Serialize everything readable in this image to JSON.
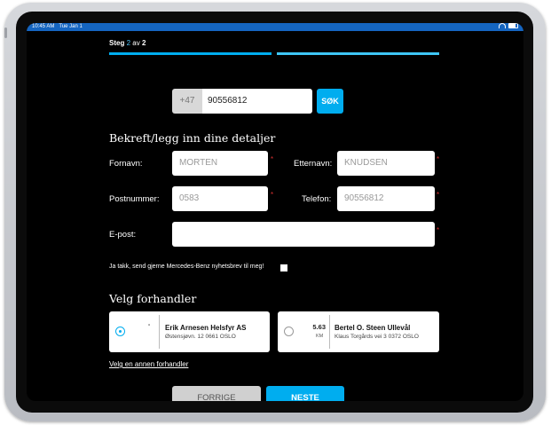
{
  "status": {
    "time": "10:45 AM",
    "date": "Tue Jan 1"
  },
  "step": {
    "prefix": "Steg",
    "current": "2",
    "middle": "av",
    "total": "2"
  },
  "phone": {
    "country_code": "+47",
    "number": "90556812",
    "search_label": "SØK"
  },
  "details": {
    "heading": "Bekreft/legg inn dine detaljer",
    "first_name": {
      "label": "Fornavn:",
      "value": "MORTEN"
    },
    "last_name": {
      "label": "Etternavn:",
      "value": "KNUDSEN"
    },
    "postal": {
      "label": "Postnummer:",
      "value": "0583"
    },
    "telephone": {
      "label": "Telefon:",
      "value": "90556812"
    },
    "email": {
      "label": "E-post:",
      "value": ""
    },
    "required_mark": "*"
  },
  "newsletter": {
    "label": "Ja takk, send gjerne Mercedes-Benz nyhetsbrev til meg!",
    "checked": false
  },
  "dealers": {
    "heading": "Velg forhandler",
    "items": [
      {
        "selected": true,
        "distance": "",
        "unit": "",
        "name": "Erik Arnesen Helsfyr AS",
        "address": "Østensjøvn. 12 0661 OSLO"
      },
      {
        "selected": false,
        "distance": "5.63",
        "unit": "KM",
        "name": "Bertel O. Steen Ullevål",
        "address": "Klaus Torgårds vei 3 0372 OSLO"
      }
    ],
    "other_link": "Velg en annen forhandler"
  },
  "buttons": {
    "back": "FORRIGE",
    "next": "NESTE"
  },
  "colors": {
    "accent": "#00adef",
    "status_bar": "#1565c0",
    "required": "#d32f2f"
  }
}
